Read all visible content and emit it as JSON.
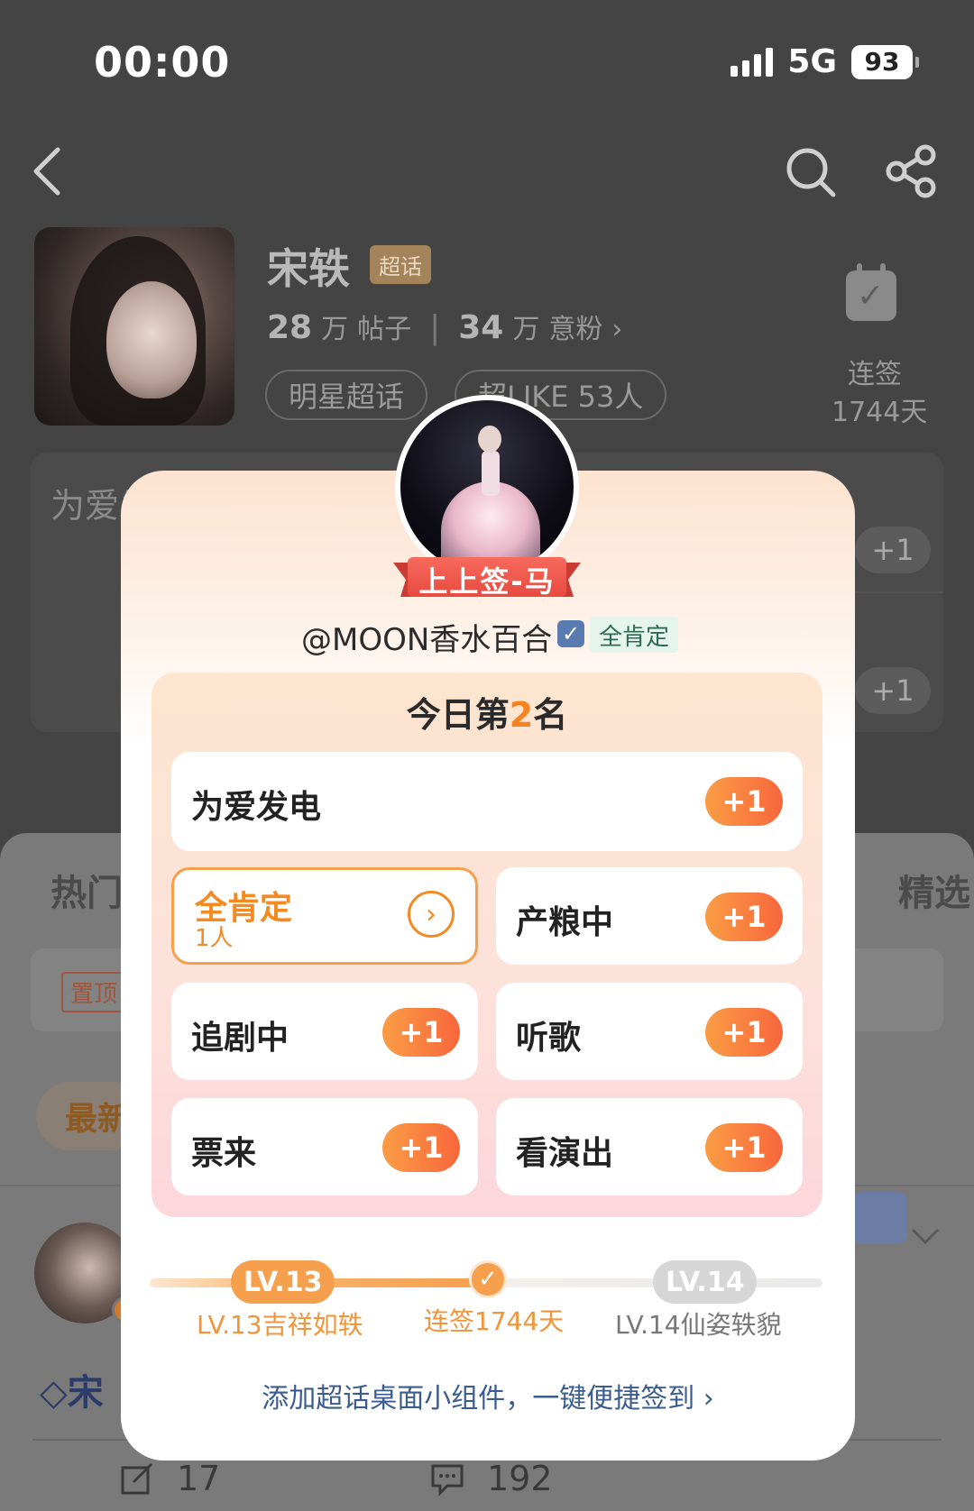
{
  "status_bar": {
    "time": "00:00",
    "network": "5G",
    "battery": "93"
  },
  "topic": {
    "name": "宋轶",
    "badge": "超话",
    "posts_num": "28",
    "posts_unit": "万",
    "posts_label": "帖子",
    "fans_num": "34",
    "fans_unit": "万",
    "fans_label": "意粉",
    "tag_star": "明星超话",
    "tag_like": "超LIKE 53人",
    "checkin_label": "连签",
    "checkin_days": "1744天"
  },
  "background_panel": {
    "first_item": "为爱发",
    "plus": "+1"
  },
  "feed": {
    "tab_hot": "热门",
    "tab_pick": "精选",
    "pin_label": "置顶",
    "newest": "最新",
    "user_name": "宋",
    "footer": {
      "repost_count": "17",
      "comment_count": "192"
    }
  },
  "card": {
    "fortune": "上上签-马",
    "username": "@MOON香水百合",
    "verify_tag": "全肯定",
    "rank_prefix": "今日第",
    "rank_num": "2",
    "rank_suffix": "名",
    "options": {
      "love": "为爱发电",
      "affirm": "全肯定",
      "affirm_count": "1人",
      "produce": "产粮中",
      "drama": "追剧中",
      "music": "听歌",
      "ticket": "票来",
      "concert": "看演出",
      "plus": "+1"
    },
    "levels": {
      "current": "LV.13",
      "current_caption": "LV.13吉祥如轶",
      "streak_caption": "连签1744天",
      "next": "LV.14",
      "next_caption": "LV.14仙姿轶貌",
      "progress_fraction": 0.5
    },
    "widget_hint": "添加超话桌面小组件，一键便捷签到 ›"
  },
  "colors": {
    "accent_orange": "#f5831f",
    "plus_gradient_start": "#fb9d45",
    "plus_gradient_end": "#f7663c",
    "ribbon_red": "#f0574d",
    "link_blue": "#3b5c8f"
  }
}
